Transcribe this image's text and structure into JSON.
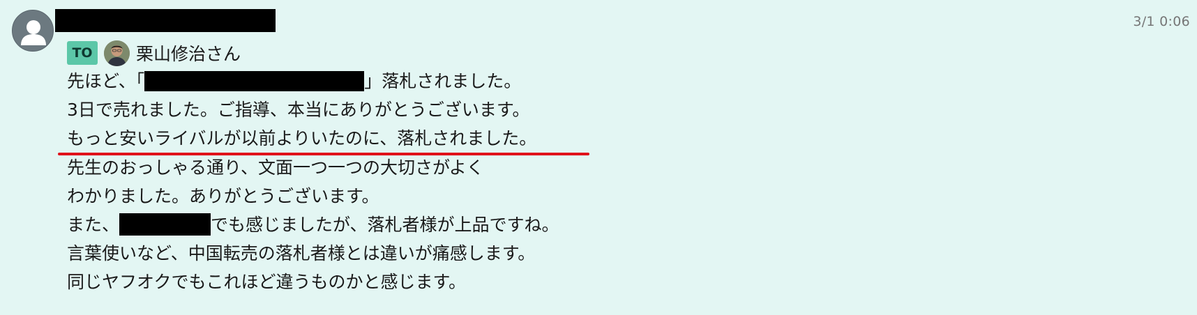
{
  "message": {
    "timestamp": "3/1 0:06",
    "sender_avatar_icon": "default-user-icon",
    "to": {
      "badge": "TO",
      "recipient_name": "栗山修治さん",
      "recipient_avatar_icon": "recipient-photo-avatar"
    },
    "lines": {
      "l1_before": "先ほど、「",
      "l1_after": "」落札されました。",
      "l2": "3日で売れました。ご指導、本当にありがとうございます。",
      "l3": "もっと安いライバルが以前よりいたのに、落札されました。",
      "l4": "先生のおっしゃる通り、文面一つ一つの大切さがよく",
      "l5": "わかりました。ありがとうございます。",
      "l6_before": "また、",
      "l6_after": "でも感じましたが、落札者様が上品ですね。",
      "l7": "言葉使いなど、中国転売の落札者様とは違いが痛感します。",
      "l8": "同じヤフオクでもこれほど違うものかと感じます。"
    },
    "colors": {
      "background": "#e3f6f3",
      "to_badge": "#5cc7a8",
      "highlight_underline": "#e0121b",
      "redaction": "#000000"
    }
  }
}
